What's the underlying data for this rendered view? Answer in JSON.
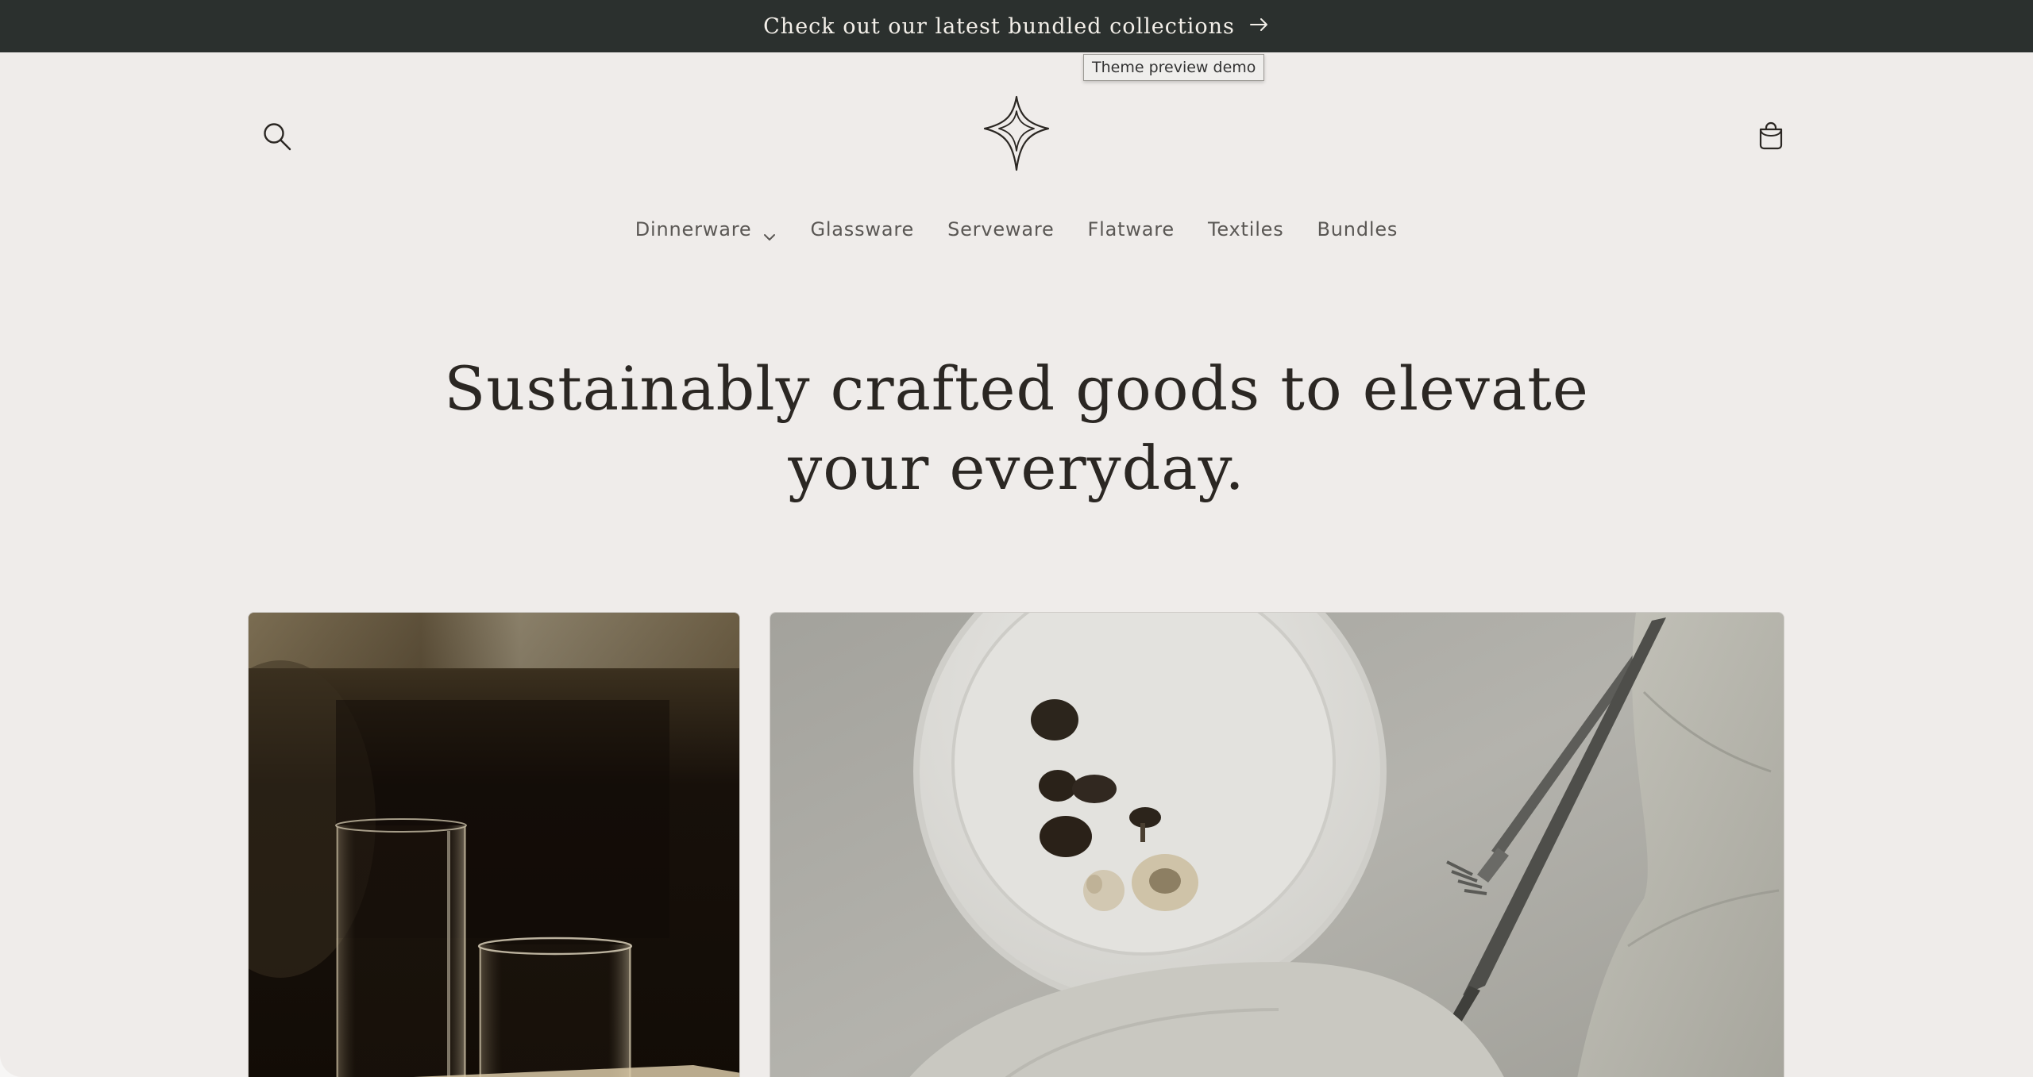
{
  "announcement": {
    "text": "Check out our latest bundled collections",
    "arrow_icon": "arrow-right-icon"
  },
  "tooltip": {
    "text": "Theme preview demo"
  },
  "header": {
    "search_icon": "search-icon",
    "logo_icon": "four-point-star-logo-icon",
    "cart_icon": "shopping-bag-icon"
  },
  "nav": {
    "items": [
      {
        "label": "Dinnerware",
        "has_dropdown": true
      },
      {
        "label": "Glassware"
      },
      {
        "label": "Serveware"
      },
      {
        "label": "Flatware"
      },
      {
        "label": "Textiles"
      },
      {
        "label": "Bundles"
      }
    ]
  },
  "hero": {
    "title_line1": "Sustainably crafted goods to elevate",
    "title_line2": "your everyday."
  },
  "colors": {
    "announcement_bg": "#2b302e",
    "page_bg": "#efecea",
    "text_dark": "#2b2723",
    "nav_text": "#5a5754"
  }
}
